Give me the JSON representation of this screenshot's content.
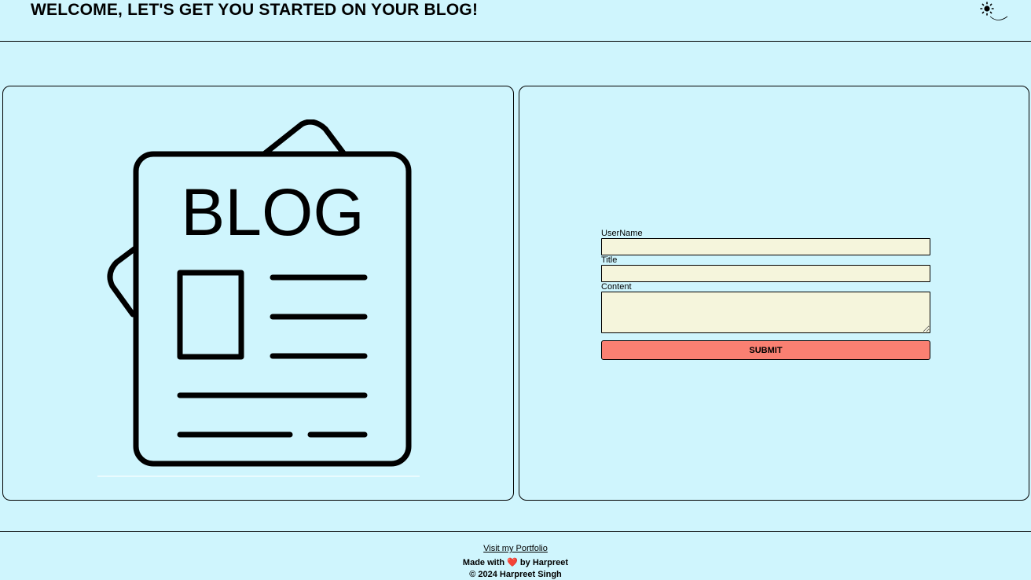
{
  "header": {
    "title": "WELCOME, LET'S GET YOU STARTED ON YOUR BLOG!",
    "theme_toggle": {
      "icons": [
        "sun-icon",
        "moon-icon"
      ]
    }
  },
  "illustration": {
    "icon": "blog-newspaper-icon",
    "text": "BLOG"
  },
  "form": {
    "username_label": "UserName",
    "username_value": "",
    "title_label": "Title",
    "title_value": "",
    "content_label": "Content",
    "content_value": "",
    "submit_label": "SUBMIT",
    "colors": {
      "input_bg": "#f5f5dc",
      "submit_bg": "#fa8072"
    }
  },
  "footer": {
    "portfolio_link": "Visit my Portfolio",
    "made_with_prefix": "Made with",
    "heart": "❤️",
    "made_with_suffix": "by Harpreet",
    "copyright": "© 2024 Harpreet Singh"
  },
  "colors": {
    "background": "#cff5fd"
  }
}
